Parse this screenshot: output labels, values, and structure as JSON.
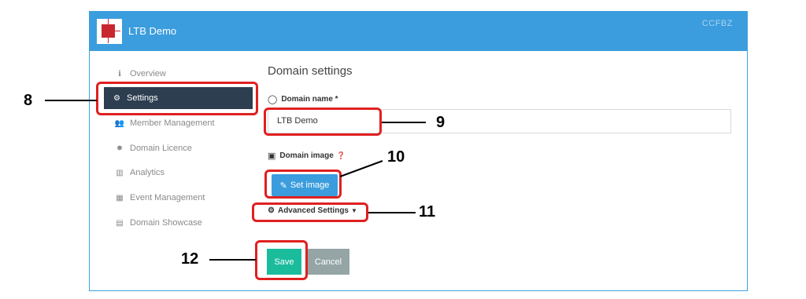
{
  "header": {
    "app_title": "LTB Demo",
    "code": "CCFBZ"
  },
  "sidebar": {
    "items": [
      {
        "label": "Overview",
        "icon": "info-icon"
      },
      {
        "label": "Settings",
        "icon": "gear-icon",
        "active": true
      },
      {
        "label": "Member Management",
        "icon": "users-icon"
      },
      {
        "label": "Domain Licence",
        "icon": "certificate-icon"
      },
      {
        "label": "Analytics",
        "icon": "chart-icon"
      },
      {
        "label": "Event Management",
        "icon": "calendar-icon"
      },
      {
        "label": "Domain Showcase",
        "icon": "showcase-icon"
      }
    ]
  },
  "main": {
    "title": "Domain settings",
    "domain_name_label": "Domain name *",
    "domain_name_value": "LTB Demo",
    "domain_image_label": "Domain image",
    "set_image_label": "Set image",
    "advanced_label": "Advanced Settings",
    "save_label": "Save",
    "cancel_label": "Cancel"
  },
  "callouts": [
    "8",
    "9",
    "10",
    "11",
    "12"
  ],
  "colors": {
    "header": "#3b9ddd",
    "active_nav": "#2c3e50",
    "save": "#1abc9c",
    "cancel": "#95a5a6",
    "callout": "#e02020"
  }
}
